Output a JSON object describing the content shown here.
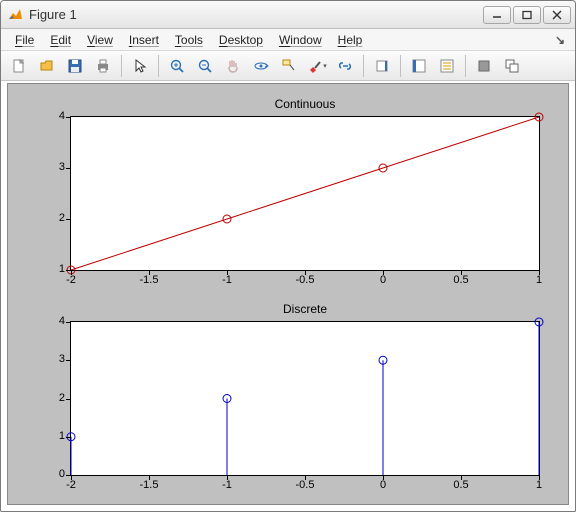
{
  "window": {
    "title": "Figure 1"
  },
  "menubar": {
    "items": [
      "File",
      "Edit",
      "View",
      "Insert",
      "Tools",
      "Desktop",
      "Window",
      "Help"
    ]
  },
  "toolbar": {
    "icons": [
      "new-file-icon",
      "open-file-icon",
      "save-icon",
      "print-icon",
      "|",
      "pointer-icon",
      "|",
      "zoom-in-icon",
      "zoom-out-icon",
      "pan-icon",
      "rotate3d-icon",
      "data-cursor-icon",
      "brush-icon",
      "link-icon",
      "|",
      "colorbar-icon",
      "|",
      "insert-legend-icon",
      "insert-colorbar-icon",
      "|",
      "hide-plot-tools-icon",
      "show-plot-tools-icon"
    ]
  },
  "chart_data": [
    {
      "type": "line",
      "title": "Continuous",
      "x": [
        -2,
        -1,
        0,
        1
      ],
      "y": [
        1,
        2,
        3,
        4
      ],
      "xlabel": "",
      "ylabel": "",
      "xlim": [
        -2,
        1
      ],
      "ylim": [
        1,
        4
      ],
      "xticks": [
        -2,
        -1.5,
        -1,
        -0.5,
        0,
        0.5,
        1
      ],
      "yticks": [
        1,
        2,
        3,
        4
      ],
      "line_color": "#c00000",
      "marker": "o",
      "marker_color": "#c00000"
    },
    {
      "type": "stem",
      "title": "Discrete",
      "x": [
        -2,
        -1,
        0,
        1
      ],
      "y": [
        1,
        2,
        3,
        4
      ],
      "xlabel": "",
      "ylabel": "",
      "xlim": [
        -2,
        1
      ],
      "ylim": [
        0,
        4
      ],
      "xticks": [
        -2,
        -1.5,
        -1,
        -0.5,
        0,
        0.5,
        1
      ],
      "yticks": [
        0,
        1,
        2,
        3,
        4
      ],
      "stem_color": "#0000cc",
      "marker": "o",
      "marker_color": "#0000cc"
    }
  ]
}
